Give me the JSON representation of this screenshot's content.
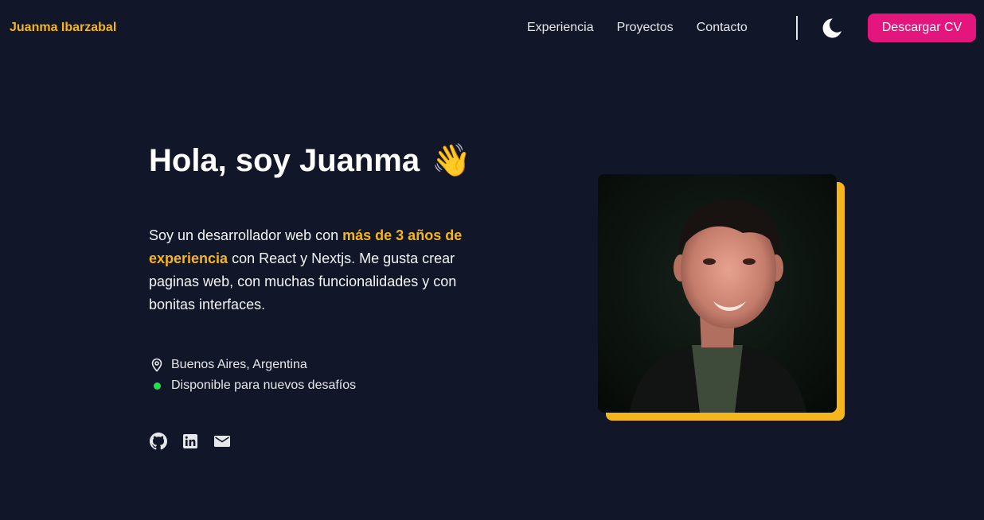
{
  "header": {
    "brand": "Juanma Ibarzabal",
    "nav": [
      {
        "label": "Experiencia"
      },
      {
        "label": "Proyectos"
      },
      {
        "label": "Contacto"
      }
    ],
    "theme_icon": "moon-icon",
    "cv_button": "Descargar CV"
  },
  "hero": {
    "title": "Hola, soy Juanma",
    "wave_emoji": "👋",
    "bio": {
      "part1": "Soy un desarrollador web con ",
      "highlight": "más de 3 años de experiencia",
      "part2": " con React y Nextjs. Me gusta crear paginas web, con muchas funcionalidades y con bonitas interfaces."
    },
    "location": "Buenos Aires, Argentina",
    "availability": "Disponible para nuevos desafíos",
    "socials": [
      {
        "icon": "github-icon"
      },
      {
        "icon": "linkedin-icon"
      },
      {
        "icon": "mail-icon"
      }
    ]
  },
  "colors": {
    "background": "#121629",
    "accent": "#f5b51c",
    "button": "#e4167e",
    "status": "#22e14b"
  }
}
